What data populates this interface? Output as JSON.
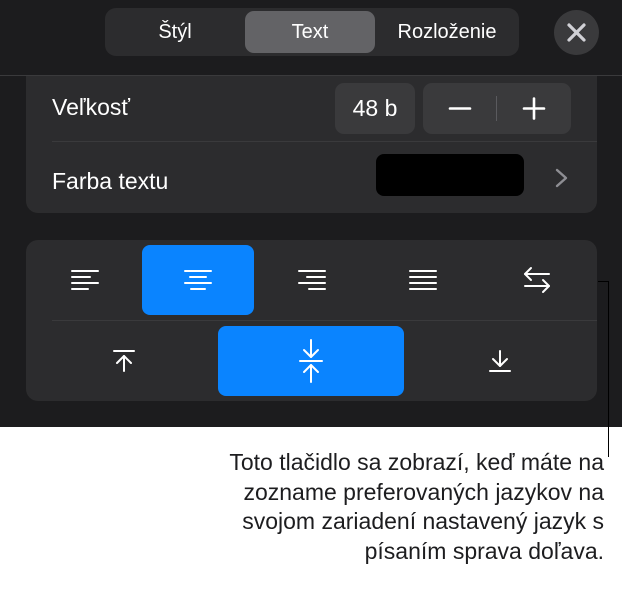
{
  "tabs": [
    {
      "label": "Štýl",
      "active": false
    },
    {
      "label": "Text",
      "active": true
    },
    {
      "label": "Rozloženie",
      "active": false
    }
  ],
  "close_icon": "close-icon",
  "size": {
    "label": "Veľkosť",
    "value": "48 b",
    "decrease_icon": "minus-icon",
    "increase_icon": "plus-icon"
  },
  "text_color": {
    "label": "Farba textu",
    "color": "#000000",
    "chevron_icon": "chevron-right-icon"
  },
  "alignment": {
    "horizontal": [
      "align-left-icon",
      "align-center-icon",
      "align-right-icon",
      "justify-icon",
      "text-direction-icon"
    ],
    "horizontal_selected": "align-center-icon",
    "vertical": [
      "align-top-icon",
      "align-middle-icon",
      "align-bottom-icon"
    ],
    "vertical_selected": "align-middle-icon"
  },
  "colors": {
    "accent": "#0a84ff",
    "panel": "#1c1c1e",
    "group": "#2c2c2e"
  },
  "callout": {
    "lines": [
      "Toto tlačidlo sa zobrazí, keď máte na",
      "zozname preferovaných jazykov na",
      "svojom zariadení nastavený jazyk s",
      "písaním sprava doľava."
    ]
  }
}
